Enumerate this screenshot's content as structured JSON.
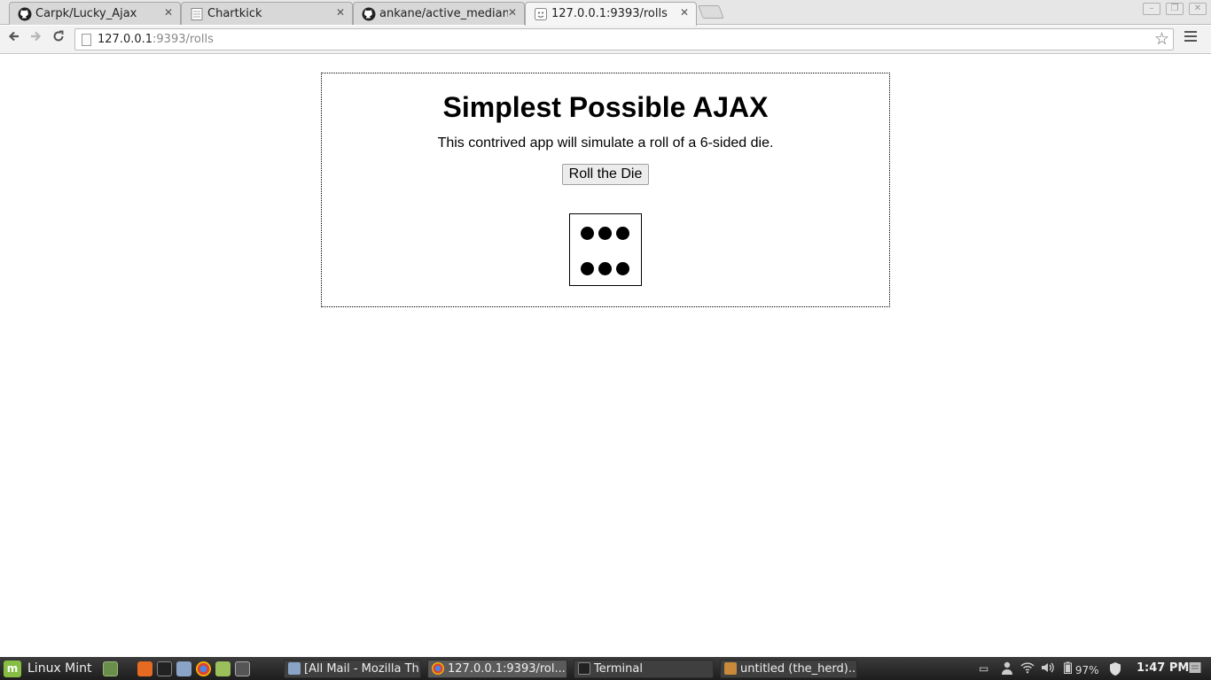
{
  "browser": {
    "tabs": [
      {
        "title": "Carpk/Lucky_Ajax",
        "icon": "github-icon"
      },
      {
        "title": "Chartkick",
        "icon": "page-icon"
      },
      {
        "title": "ankane/active_median",
        "icon": "github-icon"
      },
      {
        "title": "127.0.0.1:9393/rolls",
        "icon": "loading-icon"
      }
    ],
    "close_glyph": "✕",
    "url_host": "127.0.0.1",
    "url_path": ":9393/rolls"
  },
  "page": {
    "heading": "Simplest Possible AJAX",
    "description": "This contrived app will simulate a roll of a 6-sided die.",
    "roll_button_label": "Roll the Die",
    "die_value": 6
  },
  "taskbar": {
    "menu_label": "Linux Mint",
    "windows": [
      {
        "title": "[All Mail - Mozilla Th...",
        "icon": "thunderbird-icon"
      },
      {
        "title": "127.0.0.1:9393/rol...",
        "icon": "chrome-icon"
      },
      {
        "title": "Terminal",
        "icon": "terminal-icon"
      },
      {
        "title": "untitled (the_herd)...",
        "icon": "sublime-icon"
      }
    ],
    "battery": "97%",
    "clock": "1:47 PM"
  },
  "colors": {
    "mint_green": "#86be43",
    "die_pip": "#000000"
  }
}
